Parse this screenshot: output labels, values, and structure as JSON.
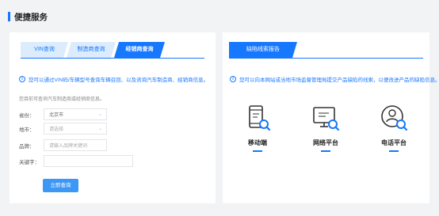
{
  "page": {
    "title": "便捷服务"
  },
  "left_panel": {
    "tabs": [
      {
        "label": "VIN查询"
      },
      {
        "label": "制造商查询"
      },
      {
        "label": "经销商查询"
      }
    ],
    "notice": "您可以通过VIN码/车辆型号查询车辆召回、以及咨询汽车制造商、经销商信息。",
    "hint": "您目前可查询汽车制造商或经销商信息。",
    "form": {
      "province_label": "省份：",
      "province_value": "北京市",
      "city_label": "地市：",
      "city_value": "请选择",
      "brand_label": "品牌：",
      "brand_placeholder": "请输入品牌关键词",
      "keyword_label": "关键字：",
      "keyword_placeholder": ""
    },
    "query_button": "立即查询"
  },
  "right_panel": {
    "tab": "缺陷线索报告",
    "notice": "您可以向本网站或当地市场监督管理局提交产品缺陷的线索，以便改进产品的缺陷信息。",
    "platforms": [
      {
        "label": "移动端",
        "icon": "mobile-search-icon"
      },
      {
        "label": "网络平台",
        "icon": "monitor-search-icon"
      },
      {
        "label": "电话平台",
        "icon": "phone-user-search-icon"
      }
    ]
  },
  "colors": {
    "accent": "#1677ff",
    "tab_light": "#dcecfc"
  }
}
